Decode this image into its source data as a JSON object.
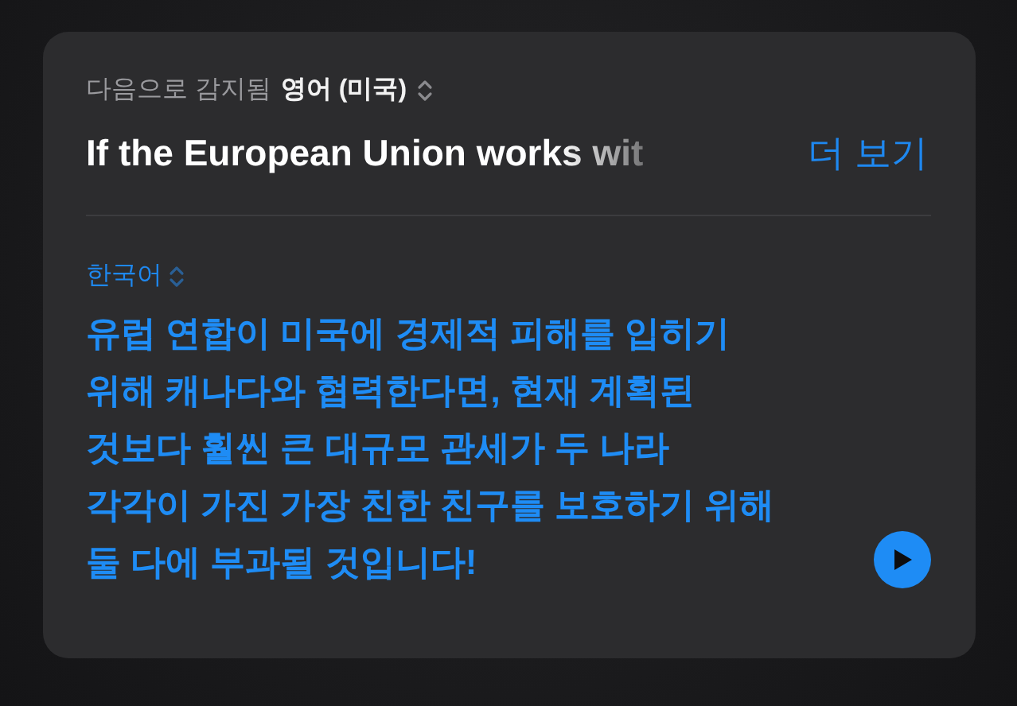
{
  "source": {
    "detected_label": "다음으로 감지됨",
    "language": "영어 (미국)",
    "text": "If the European Union works wit",
    "more_link": "더 보기"
  },
  "translation": {
    "language": "한국어",
    "text": "유럽 연합이 미국에 경제적 피해를 입히기\n위해 캐나다와 협력한다면, 현재 계획된\n것보다 훨씬 큰 대규모 관세가 두 나라\n각각이 가진 가장 친한 친구를 보호하기 위해\n둘 다에 부과될 것입니다!"
  }
}
